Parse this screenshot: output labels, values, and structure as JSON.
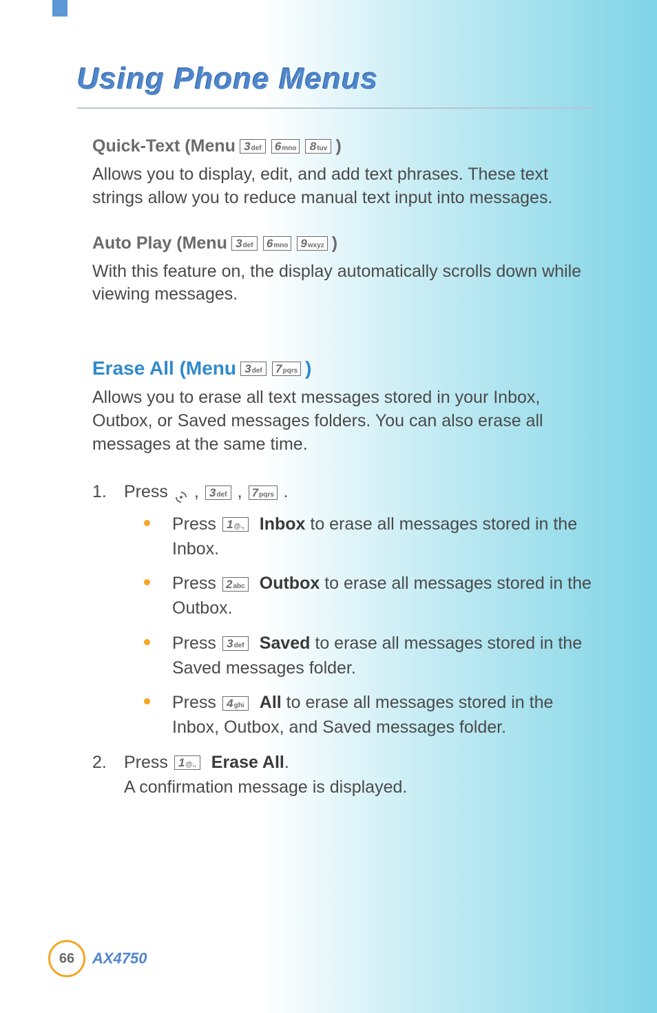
{
  "header": {
    "title": "Using Phone Menus"
  },
  "keys": {
    "k1": {
      "num": "1",
      "sub": "@.,"
    },
    "k2": {
      "num": "2",
      "sub": "abc"
    },
    "k3": {
      "num": "3",
      "sub": "def"
    },
    "k4": {
      "num": "4",
      "sub": "ghi"
    },
    "k6": {
      "num": "6",
      "sub": "mno"
    },
    "k7": {
      "num": "7",
      "sub": "pqrs"
    },
    "k8": {
      "num": "8",
      "sub": "tuv"
    },
    "k9": {
      "num": "9",
      "sub": "wxyz"
    }
  },
  "sections": {
    "quickText": {
      "label": "Quick-Text (Menu ",
      "close": ")",
      "body": "Allows you to display, edit, and add text phrases. These text strings allow you to reduce manual text input into messages."
    },
    "autoPlay": {
      "label": "Auto Play (Menu ",
      "close": ")",
      "body": "With this feature on, the display automatically scrolls down while viewing messages."
    },
    "eraseAll": {
      "label": "Erase All (Menu ",
      "close": ")",
      "intro": "Allows you to erase all text messages stored in your Inbox, Outbox, or Saved messages folders. You can also erase all messages at the same time.",
      "step1_a": "Press  ",
      "step1_punc": " ,  ",
      "step1_end": " .",
      "bullets": {
        "b1_prefix": "Press  ",
        "b1_bold": "Inbox",
        "b1_rest": " to erase all messages stored in the Inbox.",
        "b2_prefix": "Press  ",
        "b2_bold": "Outbox",
        "b2_rest": " to erase all messages stored in the Outbox.",
        "b3_prefix": "Press  ",
        "b3_bold": "Saved",
        "b3_rest": " to erase all messages stored in the Saved messages folder.",
        "b4_prefix": "Press  ",
        "b4_bold": "All",
        "b4_rest": " to erase all messages stored in the Inbox, Outbox, and Saved messages folder."
      },
      "step2_prefix": "Press  ",
      "step2_bold": "Erase All",
      "step2_dot": ".",
      "step2_line2": "A confirmation message is displayed."
    }
  },
  "footer": {
    "page": "66",
    "model": "AX4750"
  }
}
